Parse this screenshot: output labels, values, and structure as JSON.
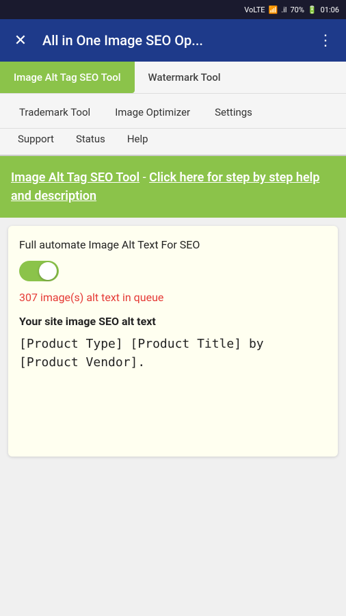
{
  "statusBar": {
    "signal": "VoLTE",
    "wifi": "WiFi",
    "network": "4G",
    "battery": "70%",
    "time": "01:06"
  },
  "header": {
    "title": "All in One Image SEO Op...",
    "closeIcon": "✕",
    "menuIcon": "⋮"
  },
  "primaryTabs": [
    {
      "label": "Image Alt Tag SEO Tool",
      "active": true
    },
    {
      "label": "Watermark Tool",
      "active": false
    }
  ],
  "secondaryNav": {
    "row1": [
      {
        "label": "Trademark Tool"
      },
      {
        "label": "Image Optimizer"
      },
      {
        "label": "Settings"
      }
    ],
    "row2": [
      {
        "label": "Support"
      },
      {
        "label": "Status"
      },
      {
        "label": "Help"
      }
    ]
  },
  "banner": {
    "toolName": "Image Alt Tag SEO Tool",
    "separator": " - ",
    "linkText": "Click here for step by step help and description"
  },
  "mainCard": {
    "toggleLabel": "Full automate Image Alt Text For SEO",
    "toggleEnabled": true,
    "queueText": "307 image(s) alt text in queue",
    "altTextLabel": "Your site image SEO alt text",
    "altTextValue": "[Product Type] [Product Title] by [Product Vendor]."
  }
}
